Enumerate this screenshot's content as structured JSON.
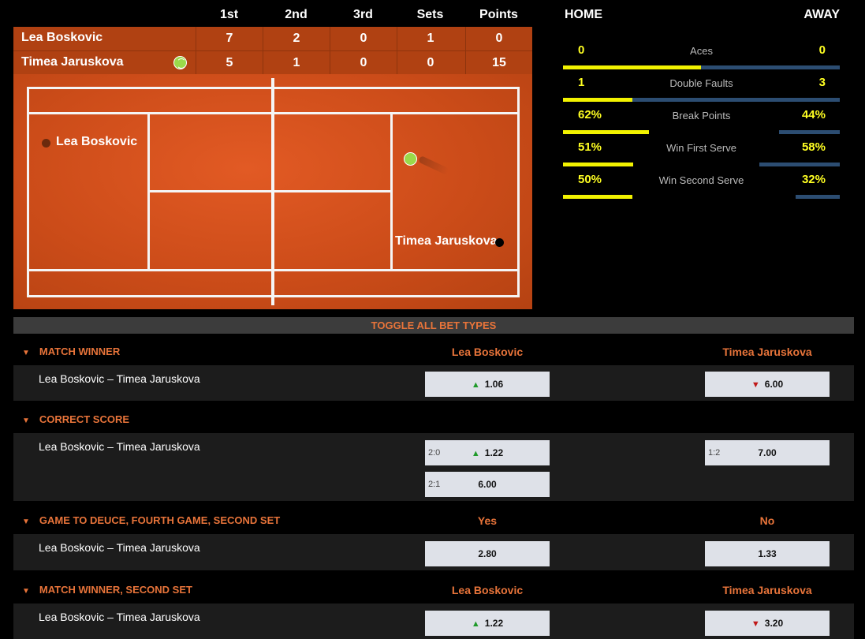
{
  "scoreboard": {
    "columns": [
      "1st",
      "2nd",
      "3rd",
      "Sets",
      "Points"
    ],
    "players": [
      {
        "name": "Lea Boskovic",
        "scores": [
          "7",
          "2",
          "0",
          "1",
          "0"
        ],
        "serving": false
      },
      {
        "name": "Timea Jaruskova",
        "scores": [
          "5",
          "1",
          "0",
          "0",
          "15"
        ],
        "serving": true
      }
    ]
  },
  "court": {
    "player1_label": "Lea Boskovic",
    "player2_label": "Timea Jaruskova"
  },
  "stats": {
    "home_label": "HOME",
    "away_label": "AWAY",
    "rows": [
      {
        "label": "Aces",
        "home": "0",
        "away": "0",
        "home_share": 0.5
      },
      {
        "label": "Double Faults",
        "home": "1",
        "away": "3",
        "home_share": 0.25
      },
      {
        "label": "Break Points",
        "home": "62%",
        "away": "44%",
        "home_fill": 0.62,
        "away_fill": 0.44
      },
      {
        "label": "Win First Serve",
        "home": "51%",
        "away": "58%",
        "home_fill": 0.51,
        "away_fill": 0.58
      },
      {
        "label": "Win Second Serve",
        "home": "50%",
        "away": "32%",
        "home_fill": 0.5,
        "away_fill": 0.32
      }
    ]
  },
  "bets": {
    "toggle_label": "TOGGLE ALL BET TYPES",
    "markets": [
      {
        "title": "MATCH WINNER",
        "col1": "Lea Boskovic",
        "col2": "Timea Jaruskova",
        "event": "Lea Boskovic – Timea Jaruskova",
        "odds_left": [
          {
            "label": "",
            "value": "1.06",
            "trend": "up"
          }
        ],
        "odds_right": [
          {
            "label": "",
            "value": "6.00",
            "trend": "down"
          }
        ]
      },
      {
        "title": "CORRECT SCORE",
        "col1": "",
        "col2": "",
        "event": "Lea Boskovic – Timea Jaruskova",
        "odds_left": [
          {
            "label": "2:0",
            "value": "1.22",
            "trend": "up"
          },
          {
            "label": "2:1",
            "value": "6.00",
            "trend": ""
          }
        ],
        "odds_right": [
          {
            "label": "1:2",
            "value": "7.00",
            "trend": ""
          }
        ]
      },
      {
        "title": "GAME TO DEUCE, FOURTH GAME, SECOND SET",
        "col1": "Yes",
        "col2": "No",
        "event": "Lea Boskovic – Timea Jaruskova",
        "odds_left": [
          {
            "label": "",
            "value": "2.80",
            "trend": ""
          }
        ],
        "odds_right": [
          {
            "label": "",
            "value": "1.33",
            "trend": ""
          }
        ]
      },
      {
        "title": "MATCH WINNER, SECOND SET",
        "col1": "Lea Boskovic",
        "col2": "Timea Jaruskova",
        "event": "Lea Boskovic – Timea Jaruskova",
        "odds_left": [
          {
            "label": "",
            "value": "1.22",
            "trend": "up"
          }
        ],
        "odds_right": [
          {
            "label": "",
            "value": "3.20",
            "trend": "down"
          }
        ]
      }
    ]
  },
  "colors": {
    "accent": "#e8743a",
    "court": "#cc4c19",
    "stat_value": "#ffff22",
    "home_bar": "#f2f200",
    "away_bar": "#2c4d72"
  }
}
